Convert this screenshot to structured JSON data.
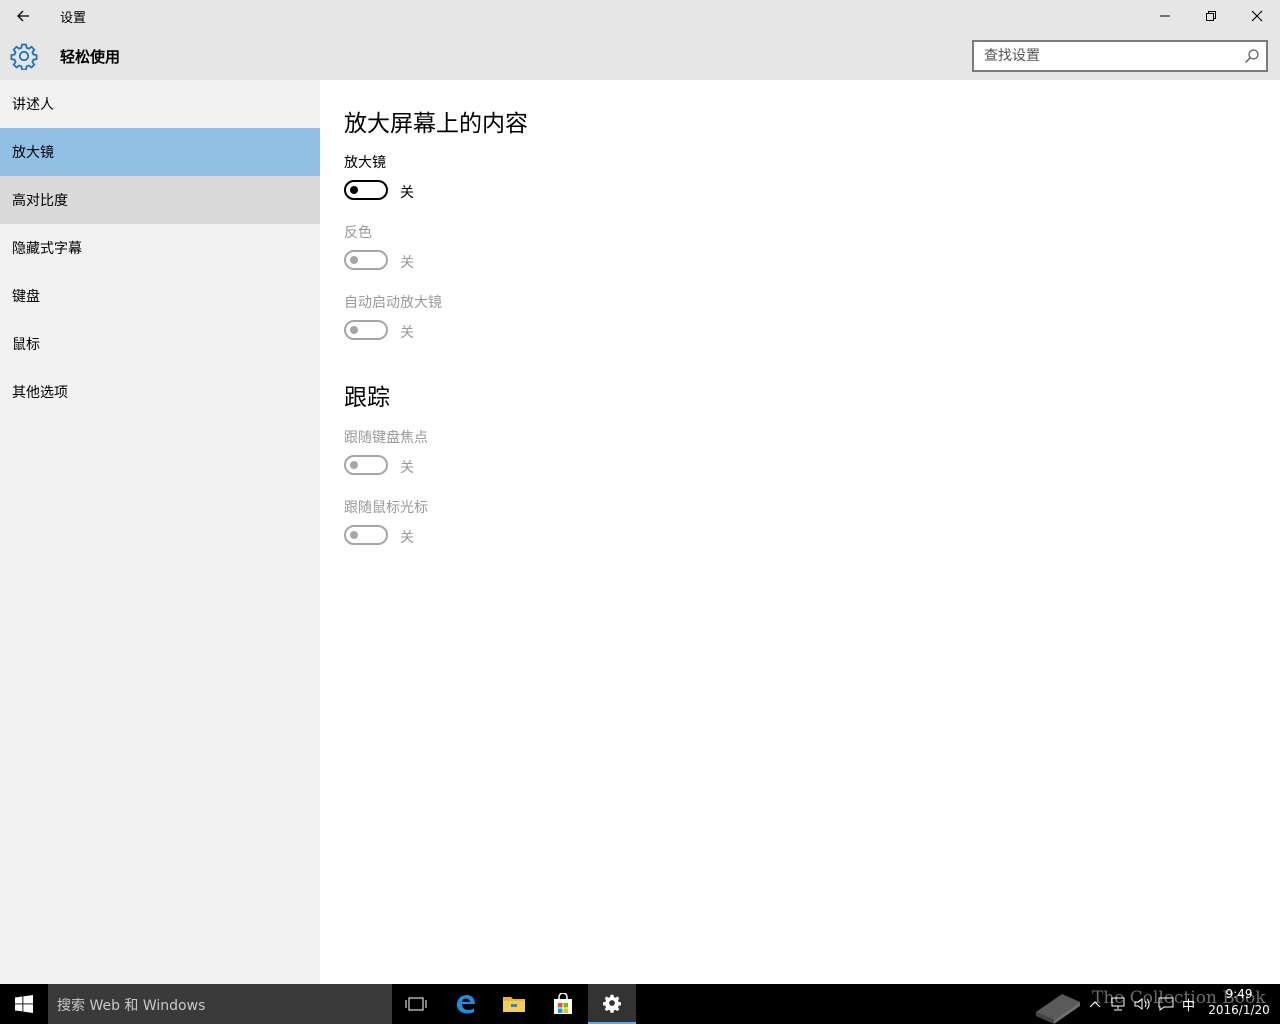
{
  "window": {
    "title": "设置",
    "back_icon": "back-arrow-icon",
    "controls": [
      "minimize-icon",
      "restore-icon",
      "close-icon"
    ]
  },
  "header": {
    "title": "轻松使用",
    "icon": "gear-icon",
    "accent_color": "#1a73c7",
    "search_placeholder": "查找设置"
  },
  "sidebar": {
    "items": [
      {
        "label": "讲述人"
      },
      {
        "label": "放大镜",
        "selected": true
      },
      {
        "label": "高对比度",
        "hover": true
      },
      {
        "label": "隐藏式字幕"
      },
      {
        "label": "键盘"
      },
      {
        "label": "鼠标"
      },
      {
        "label": "其他选项"
      }
    ],
    "selected_color": "#90c0e6"
  },
  "main": {
    "section1_title": "放大屏幕上的内容",
    "magnifier": {
      "label": "放大镜",
      "state": "关",
      "enabled": true
    },
    "invert": {
      "label": "反色",
      "state": "关",
      "enabled": false
    },
    "autostart": {
      "label": "自动启动放大镜",
      "state": "关",
      "enabled": false
    },
    "section2_title": "跟踪",
    "follow_keyboard": {
      "label": "跟随键盘焦点",
      "state": "关",
      "enabled": false
    },
    "follow_mouse": {
      "label": "跟随鼠标光标",
      "state": "关",
      "enabled": false
    }
  },
  "taskbar": {
    "search_text": "搜索 Web 和 Windows",
    "icons": [
      "windows-start-icon",
      "task-view-icon",
      "edge-icon",
      "file-explorer-icon",
      "store-icon",
      "settings-icon"
    ],
    "clock_time": "9:49",
    "clock_date": "2016/1/20",
    "tray_ime": "中",
    "watermark": "The Collection Book"
  }
}
